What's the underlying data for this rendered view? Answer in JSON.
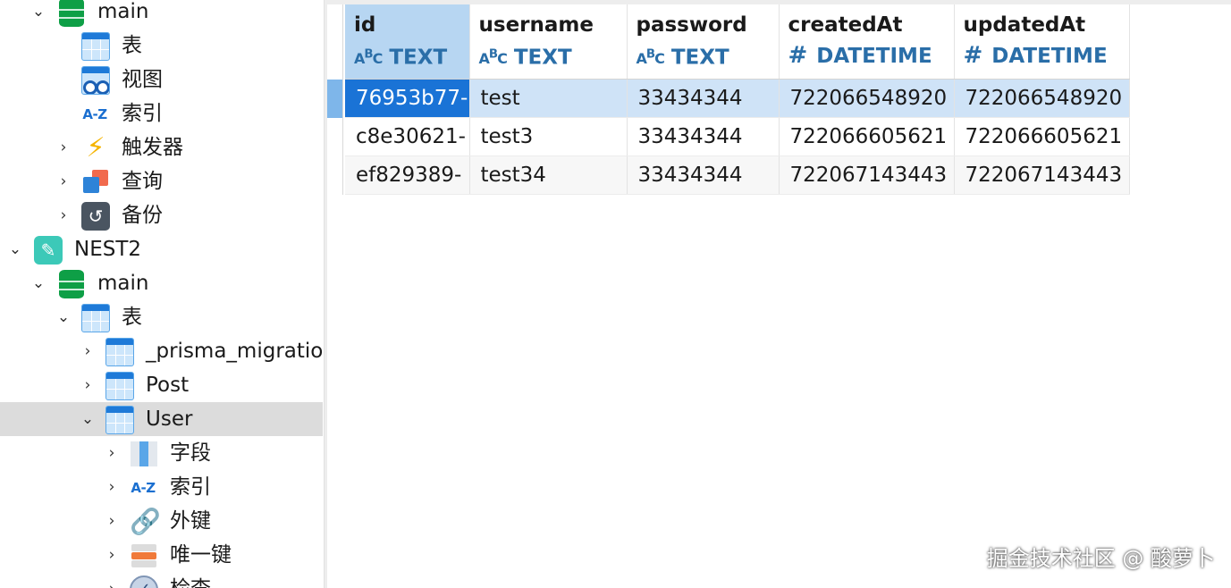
{
  "sidebar": {
    "items": [
      {
        "label": "main",
        "icon": "database-icon",
        "expanded": true
      },
      {
        "label": "表",
        "icon": "table-icon"
      },
      {
        "label": "视图",
        "icon": "view-icon"
      },
      {
        "label": "索引",
        "icon": "index-icon"
      },
      {
        "label": "触发器",
        "icon": "trigger-icon"
      },
      {
        "label": "查询",
        "icon": "query-icon"
      },
      {
        "label": "备份",
        "icon": "backup-icon"
      },
      {
        "label": "NEST2",
        "icon": "connection-icon",
        "expanded": true
      },
      {
        "label": "main",
        "icon": "database-icon",
        "expanded": true
      },
      {
        "label": "表",
        "icon": "table-icon",
        "expanded": true
      },
      {
        "label": "_prisma_migrations",
        "icon": "table-icon"
      },
      {
        "label": "Post",
        "icon": "table-icon"
      },
      {
        "label": "User",
        "icon": "table-icon",
        "expanded": true,
        "selected": true
      },
      {
        "label": "字段",
        "icon": "fields-icon"
      },
      {
        "label": "索引",
        "icon": "index-icon"
      },
      {
        "label": "外键",
        "icon": "foreign-key-icon"
      },
      {
        "label": "唯一键",
        "icon": "unique-key-icon"
      },
      {
        "label": "检查",
        "icon": "check-icon"
      }
    ]
  },
  "grid": {
    "columns": [
      {
        "name": "id",
        "type": "TEXT",
        "type_icon": "abc-icon"
      },
      {
        "name": "username",
        "type": "TEXT",
        "type_icon": "abc-icon"
      },
      {
        "name": "password",
        "type": "TEXT",
        "type_icon": "abc-icon"
      },
      {
        "name": "createdAt",
        "type": "DATETIME",
        "type_icon": "hash-icon"
      },
      {
        "name": "updatedAt",
        "type": "DATETIME",
        "type_icon": "hash-icon"
      }
    ],
    "rows": [
      [
        "76953b77-",
        "test",
        "33434344",
        "722066548920",
        "722066548920"
      ],
      [
        "c8e30621-",
        "test3",
        "33434344",
        "722066605621",
        "722066605621"
      ],
      [
        "ef829389-",
        "test34",
        "33434344",
        "722067143443",
        "722067143443"
      ]
    ]
  },
  "watermark": "掘金技术社区 @ 酸萝卜",
  "colors": {
    "selection": "#1a73d6",
    "row_highlight": "#cfe3f7",
    "type_text": "#2a6ea8",
    "tree_selected": "#dcdcdc"
  }
}
